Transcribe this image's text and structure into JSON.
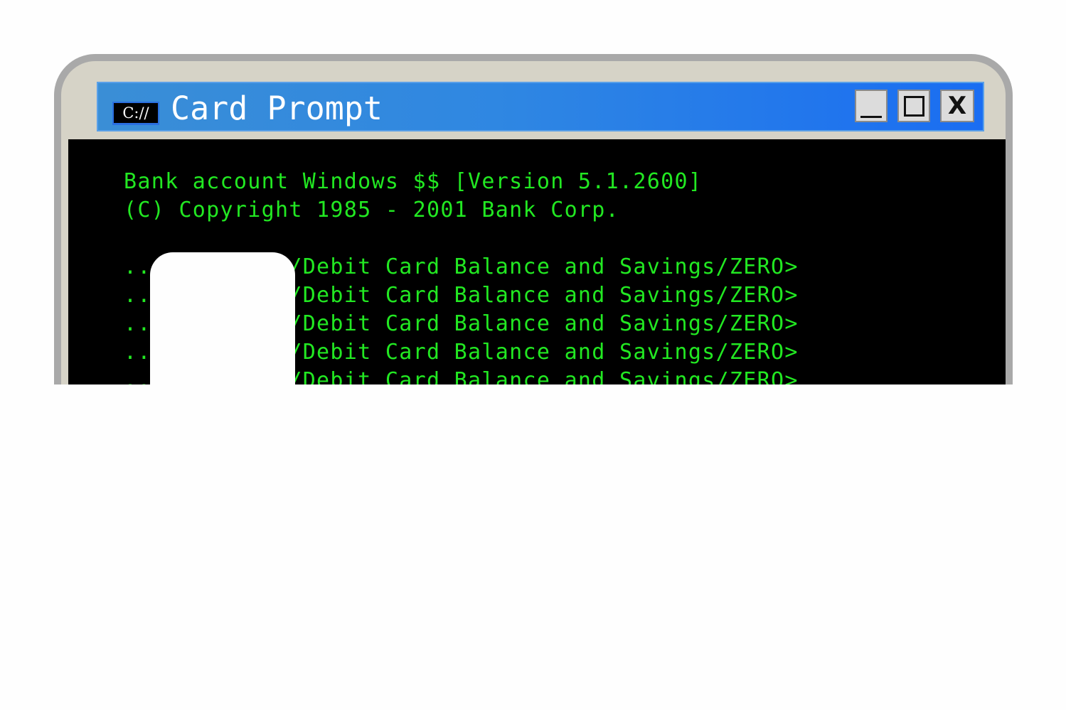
{
  "window": {
    "title": "Card Prompt",
    "icon_label": "C://",
    "icon": "command-prompt-icon",
    "controls": {
      "minimize": "minimize-icon",
      "maximize": "maximize-icon",
      "close_label": "X"
    }
  },
  "console": {
    "header_lines": [
      "Bank account Windows $$ [Version 5.1.2600]",
      "(C) Copyright 1985 - 2001 Bank Corp."
    ],
    "prompt_lines": [
      "..........C:/Debit Card Balance and Savings/ZERO>",
      "..........C:/Debit Card Balance and Savings/ZERO>",
      "..........C:/Debit Card Balance and Savings/ZERO>",
      "..........C:/Debit Card Balance and Savings/ZERO>",
      "..........C:/Debit Card Balance and Savings/ZERO>"
    ]
  },
  "colors": {
    "console_text": "#22e822",
    "console_bg": "#000000",
    "title_bar": "#2f87e2",
    "frame": "#d6d3c7"
  }
}
